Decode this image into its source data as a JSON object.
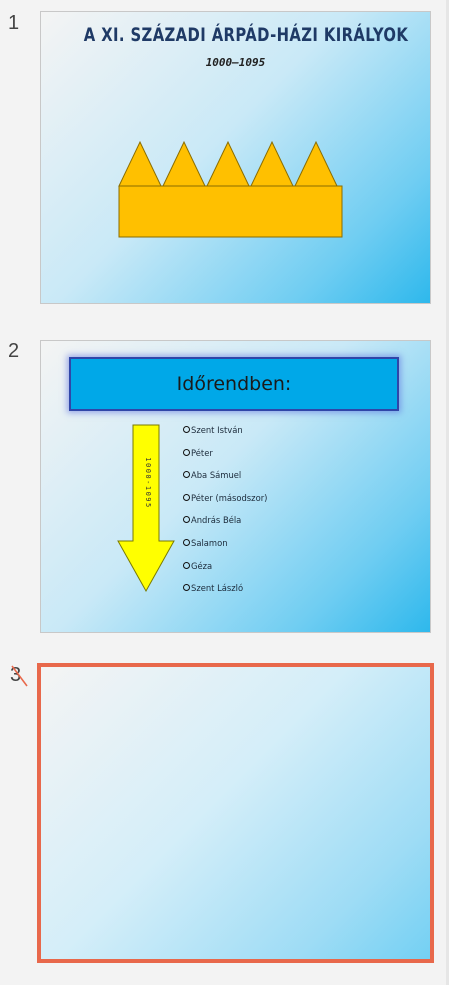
{
  "slide_panel": {
    "slides": [
      {
        "number": "1",
        "title": "A XI. SZÁZADI ÁRPÁD-HÁZI KIRÁLYOK",
        "subtitle": "1000–1095"
      },
      {
        "number": "2",
        "header": "Időrendben:",
        "arrow_label": "1000-1095",
        "list": [
          "Szent István",
          "Péter",
          "Aba Sámuel",
          "Péter (másodszor)",
          "András Béla",
          "Salamon",
          "Géza",
          "Szent László"
        ]
      },
      {
        "number": "3"
      }
    ],
    "selected_index": 3
  },
  "colors": {
    "selection_border": "#e8684b",
    "crown_fill": "#ffc000",
    "header_fill": "#00a8e8",
    "arrow_fill": "#ffff00"
  },
  "icons": [
    "crown-shape",
    "down-arrow-shape",
    "bullet-circle-icon"
  ]
}
